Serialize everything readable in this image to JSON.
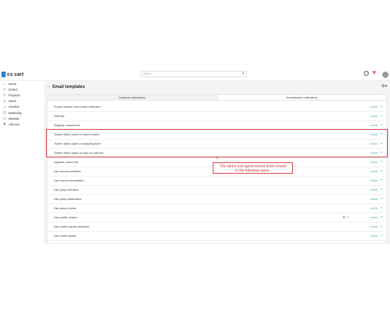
{
  "app": {
    "logo_text": "cs cart",
    "brand_color": "#2d7fd3"
  },
  "topbar": {
    "search_placeholder": "Search",
    "search_icon": "search-icon",
    "help_icon": "help-icon",
    "heart_icon": "heart-icon"
  },
  "sidebar": {
    "items": [
      {
        "label": "Home",
        "icon": "⌂"
      },
      {
        "label": "Orders",
        "icon": "▭"
      },
      {
        "label": "Products",
        "icon": "◇"
      },
      {
        "label": "Users",
        "icon": "♙"
      },
      {
        "label": "Vendors",
        "icon": "⛬"
      },
      {
        "label": "Marketing",
        "icon": "◫"
      },
      {
        "label": "Website",
        "icon": "▢"
      },
      {
        "label": "Add-ons",
        "icon": "⊕"
      }
    ]
  },
  "page": {
    "title": "Email templates"
  },
  "tabs": [
    {
      "label": "Customer notifications"
    },
    {
      "label": "Administrator notifications"
    }
  ],
  "rows": [
    {
      "name": "Product reviews: New review notification",
      "status": "Active"
    },
    {
      "name": "RMA slip",
      "status": "Active"
    },
    {
      "name": "Shipping: request error",
      "status": "Active"
    },
    {
      "name": "Tickets: Mail to admin on ticket creation",
      "status": "Active"
    },
    {
      "name": "Tickets: Mail to agent on assigning ticket",
      "status": "Active"
    },
    {
      "name": "Tickets: Mail to agent on reply by customer",
      "status": "Active"
    },
    {
      "name": "Upgrade: restore link",
      "status": "Active"
    },
    {
      "name": "User account activation",
      "status": "Active"
    },
    {
      "name": "User account deactivation",
      "status": "Active"
    },
    {
      "name": "User group activation",
      "status": "Active"
    },
    {
      "name": "User group deactivation",
      "status": "Active"
    },
    {
      "name": "User group request",
      "status": "Active"
    },
    {
      "name": "User profile creation",
      "status": "Active"
    },
    {
      "name": "User profile requires activation",
      "status": "Active"
    },
    {
      "name": "User profile update",
      "status": "Active"
    }
  ],
  "callout": {
    "line1": "The admin and agent receive ticket emails",
    "line2": "in the following cases."
  },
  "colors": {
    "highlight": "#d9363e",
    "status_active": "#3ba7c0"
  }
}
